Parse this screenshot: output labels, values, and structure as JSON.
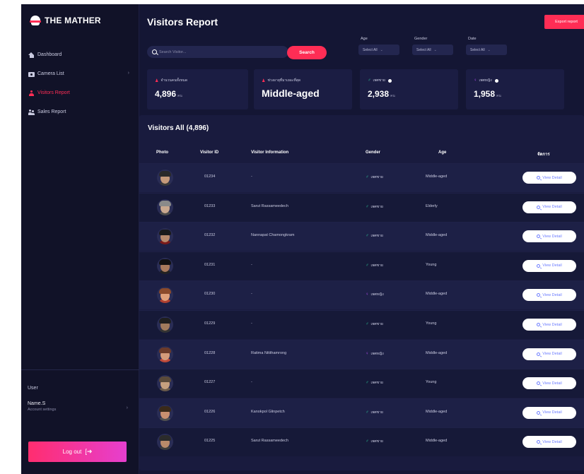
{
  "brand": {
    "name": "THE MATHER"
  },
  "sidebar": {
    "items": [
      {
        "label": "Dashboard",
        "icon": "home-icon"
      },
      {
        "label": "Camera List",
        "icon": "camera-icon",
        "has_chevron": true
      },
      {
        "label": "Visitors Report",
        "icon": "user-icon",
        "active": true
      },
      {
        "label": "Sales Report",
        "icon": "users-icon"
      }
    ],
    "user_label": "User",
    "user_name": "Name.S",
    "user_sub": "Account settings",
    "logout_label": "Log out"
  },
  "header": {
    "title": "Visitors Report",
    "export_label": "Export report"
  },
  "search": {
    "placeholder": "Search Visitor...",
    "button_label": "Search"
  },
  "filters": [
    {
      "label": "Age",
      "value": "Select All"
    },
    {
      "label": "Gender",
      "value": "Select All"
    },
    {
      "label": "Date",
      "value": "Select All"
    }
  ],
  "cards": [
    {
      "label": "จำนวนคนทั้งหมด",
      "value": "4,896",
      "unit": "คน"
    },
    {
      "label": "ช่วงอายุที่มาเยอะที่สุด",
      "value": "Middle-aged",
      "unit": ""
    },
    {
      "label": "เพศชาย",
      "value": "2,938",
      "unit": "คน"
    },
    {
      "label": "เพศหญิง",
      "value": "1,958",
      "unit": "คน"
    }
  ],
  "table": {
    "title": "Visitors All (4,896)",
    "columns": [
      "Photo",
      "Visitor ID",
      "Visitor Information",
      "Gender",
      "Age",
      "จัดการ"
    ],
    "view_label": "View Detail",
    "rows": [
      {
        "id": "01234",
        "info": "-",
        "gender": "เพศชาย",
        "gender_type": "male",
        "age": "Middle-aged"
      },
      {
        "id": "01233",
        "info": "Sarut Rassameedech",
        "gender": "เพศชาย",
        "gender_type": "male",
        "age": "Elderly"
      },
      {
        "id": "01232",
        "info": "Nannapat Chamongkram",
        "gender": "เพศชาย",
        "gender_type": "male",
        "age": "Middle-aged"
      },
      {
        "id": "01231",
        "info": "-",
        "gender": "เพศชาย",
        "gender_type": "male",
        "age": "Young"
      },
      {
        "id": "01230",
        "info": "-",
        "gender": "เพศหญิง",
        "gender_type": "female",
        "age": "Middle-aged"
      },
      {
        "id": "01229",
        "info": "-",
        "gender": "เพศชาย",
        "gender_type": "male",
        "age": "Young"
      },
      {
        "id": "01228",
        "info": "Ratima Nitithamrong",
        "gender": "เพศหญิง",
        "gender_type": "female",
        "age": "Middle-aged"
      },
      {
        "id": "01227",
        "info": "-",
        "gender": "เพศชาย",
        "gender_type": "male",
        "age": "Young"
      },
      {
        "id": "01226",
        "info": "Kanokpol Glinpetch",
        "gender": "เพศชาย",
        "gender_type": "male",
        "age": "Middle-aged"
      },
      {
        "id": "01225",
        "info": "Sarut Rassameedech",
        "gender": "เพศชาย",
        "gender_type": "male",
        "age": "Middle-aged"
      }
    ]
  },
  "colors": {
    "background": "#141634",
    "sidebar": "#111228",
    "accent": "#ff2d55",
    "male": "#2ee6a8",
    "female": "#c04dff"
  }
}
